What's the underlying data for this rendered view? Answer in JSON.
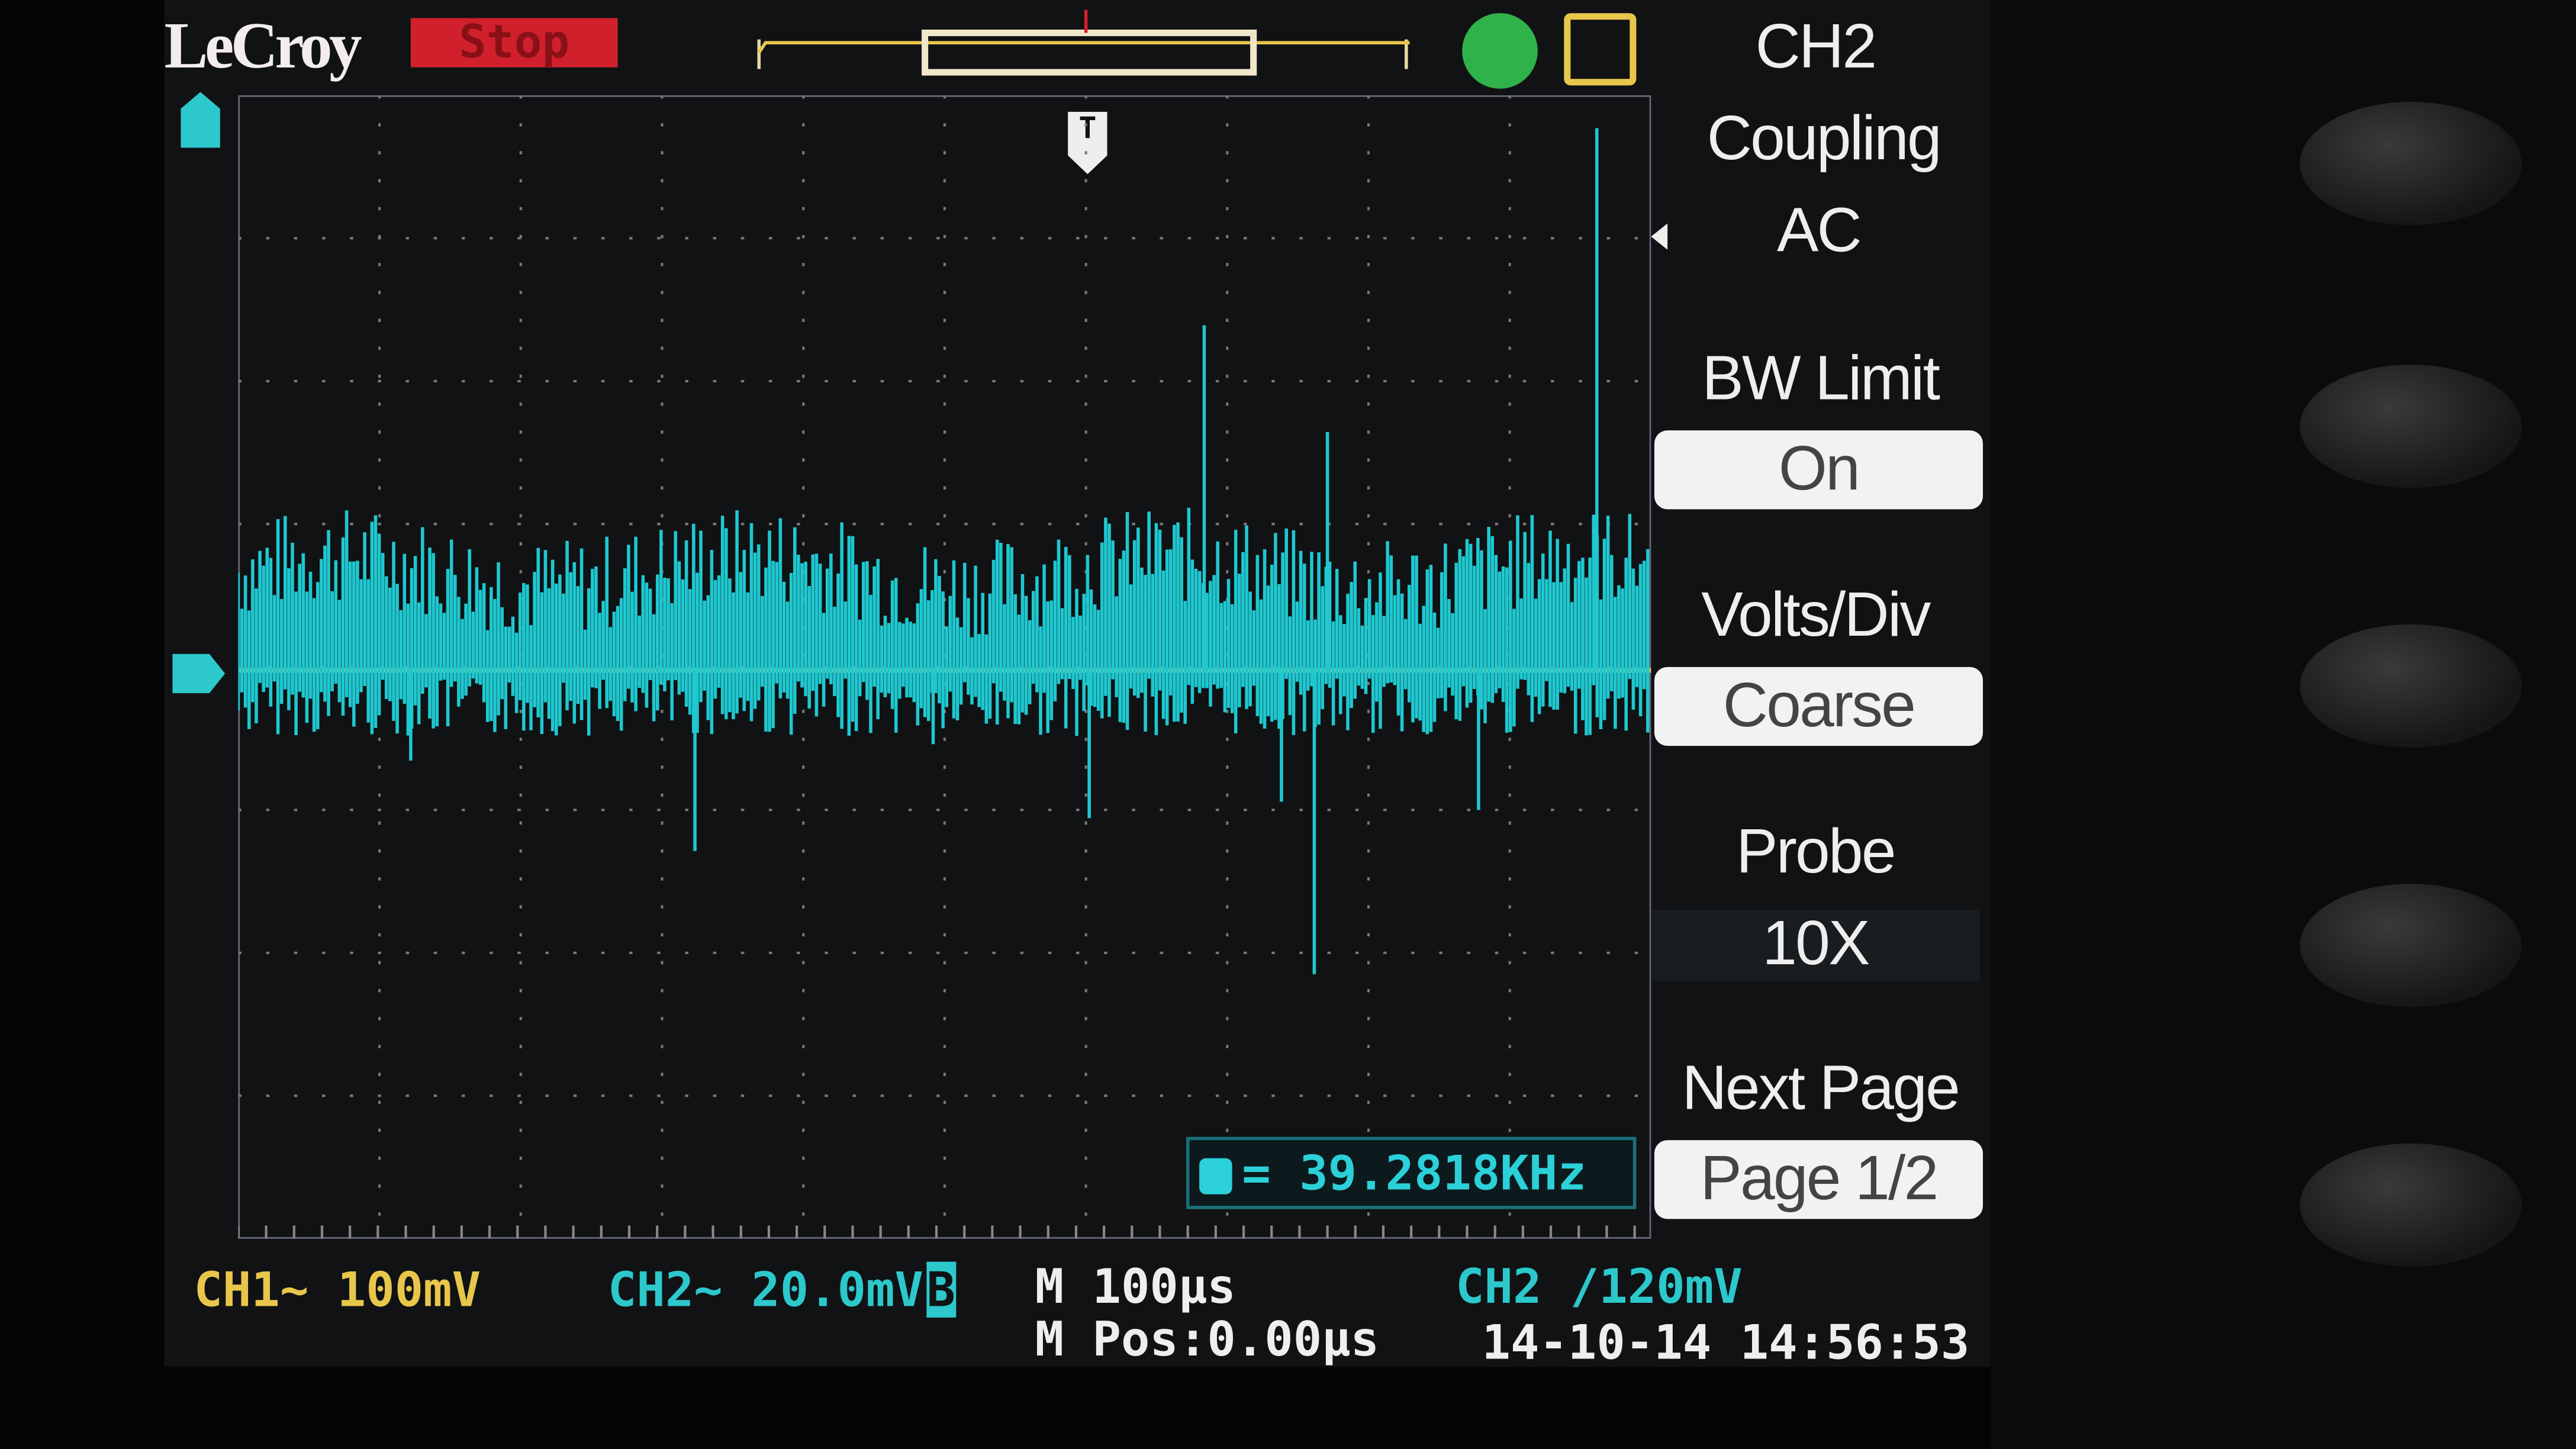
{
  "header": {
    "brand": "LeCroy",
    "run_state": "Stop"
  },
  "colors": {
    "ch1": "#e8c64a",
    "ch2": "#2cc8cc",
    "stop": "#d0202c"
  },
  "icons": {
    "trigger_marker": "trigger-T-icon",
    "ch2_ground_marker": "ch2-marker-icon",
    "usb": "usb-icon",
    "printer": "printer-icon"
  },
  "menu": {
    "channel": "CH2",
    "items": [
      {
        "label": "Coupling",
        "value": "AC"
      },
      {
        "label": "BW Limit",
        "value": "On"
      },
      {
        "label": "Volts/Div",
        "value": "Coarse"
      },
      {
        "label": "Probe",
        "value": "10X"
      },
      {
        "label": "Next Page",
        "value": "Page 1/2"
      }
    ]
  },
  "measurement": {
    "value": "= 39.2818KHz"
  },
  "status": {
    "ch1": "CH1~ 100mV",
    "ch2": "CH2~ 20.0mV",
    "ch2_bw": "B",
    "timebase": "M 100μs",
    "mpos": "M Pos:0.00μs",
    "trigger": "CH2 ∕120mV",
    "datetime": "14-10-14 14:56:53"
  }
}
